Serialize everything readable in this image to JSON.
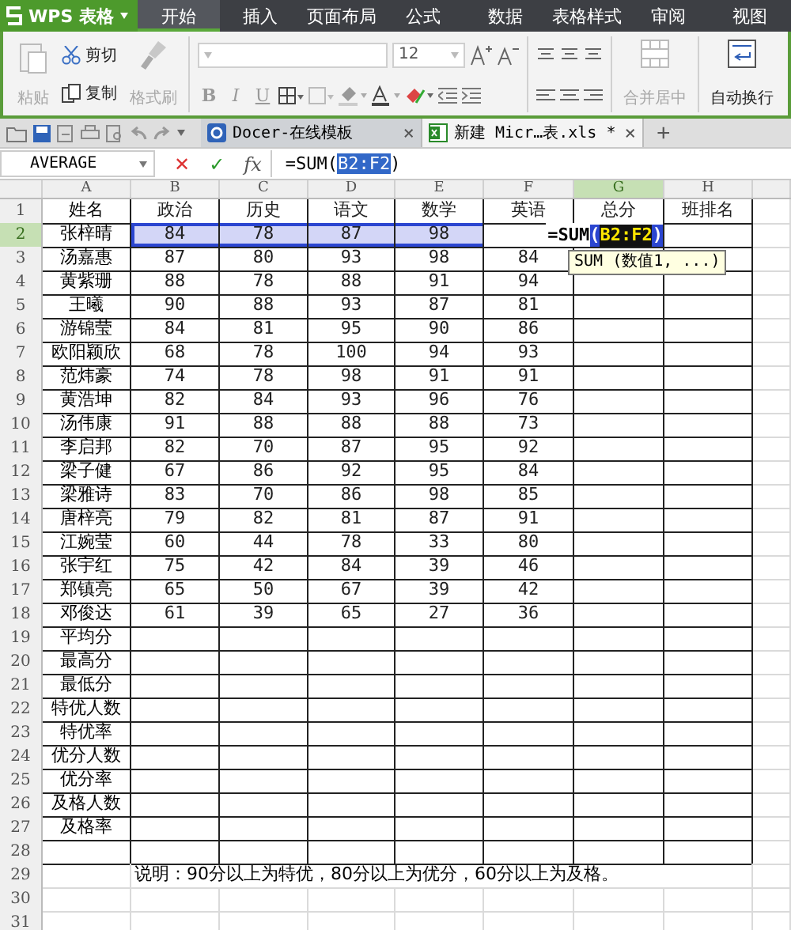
{
  "app": {
    "name": "WPS 表格"
  },
  "menu_tabs": [
    {
      "label": "开始",
      "selected": true
    },
    {
      "label": "插入",
      "selected": false
    },
    {
      "label": "页面布局",
      "selected": false
    },
    {
      "label": "公式",
      "selected": false
    },
    {
      "label": "数据",
      "selected": false
    },
    {
      "label": "表格样式",
      "selected": false
    },
    {
      "label": "审阅",
      "selected": false
    },
    {
      "label": "视图",
      "selected": false
    }
  ],
  "ribbon": {
    "paste": {
      "label": "粘贴",
      "disabled": true
    },
    "cut": {
      "label": "剪切",
      "disabled": false
    },
    "copy": {
      "label": "复制",
      "disabled": false
    },
    "format_painter": {
      "label": "格式刷",
      "disabled": true
    },
    "font_size": "12",
    "style_buttons": [
      "B",
      "I",
      "U"
    ],
    "merge": {
      "label": "合并居中",
      "disabled": true
    },
    "wrap": {
      "label": "自动换行",
      "disabled": false
    }
  },
  "doc_tabs": [
    {
      "title": "Docer-在线模板",
      "close": "×",
      "selected": false
    },
    {
      "title": "新建 Micr…表.xls *",
      "close": "×",
      "selected": true
    }
  ],
  "new_tab": "+",
  "formula_bar": {
    "name_box": "AVERAGE",
    "cancel": "✕",
    "confirm": "✓",
    "function": "fx",
    "formula": [
      {
        "text": "=SUM(",
        "kind": "plain"
      },
      {
        "text": "B2:F2",
        "kind": "ref"
      },
      {
        "text": ")",
        "kind": "plain"
      }
    ]
  },
  "sheet": {
    "columns": [
      {
        "label": "A",
        "selected": false
      },
      {
        "label": "B",
        "selected": false
      },
      {
        "label": "C",
        "selected": false
      },
      {
        "label": "D",
        "selected": false
      },
      {
        "label": "E",
        "selected": false
      },
      {
        "label": "F",
        "selected": false
      },
      {
        "label": "G",
        "selected": true
      },
      {
        "label": "H",
        "selected": false
      }
    ],
    "rows": [
      {
        "number": "1",
        "selected": false,
        "bordered": true,
        "cells": [
          {
            "text": "姓名",
            "selected": false
          },
          {
            "text": "政治",
            "selected": false
          },
          {
            "text": "历史",
            "selected": false
          },
          {
            "text": "语文",
            "selected": false
          },
          {
            "text": "数学",
            "selected": false
          },
          {
            "text": "英语",
            "selected": false
          },
          {
            "text": "总分",
            "selected": false
          },
          {
            "text": "班排名",
            "selected": false
          }
        ]
      },
      {
        "number": "2",
        "selected": true,
        "bordered": true,
        "cells": [
          {
            "text": "张梓晴",
            "selected": false
          },
          {
            "text": "84",
            "selected": true
          },
          {
            "text": "78",
            "selected": true
          },
          {
            "text": "87",
            "selected": true
          },
          {
            "text": "98",
            "selected": true
          }
        ],
        "editor": {
          "parts": [
            {
              "text": "=SUM",
              "kind": "plain"
            },
            {
              "text": "(",
              "kind": "paren"
            },
            {
              "text": "B2:F2",
              "kind": "ref"
            },
            {
              "text": ")",
              "kind": "paren"
            }
          ],
          "tooltip": "SUM (数值1, ...)"
        }
      },
      {
        "number": "3",
        "selected": false,
        "bordered": true,
        "cells": [
          {
            "text": "汤嘉惠",
            "selected": false
          },
          {
            "text": "87",
            "selected": false
          },
          {
            "text": "80",
            "selected": false
          },
          {
            "text": "93",
            "selected": false
          },
          {
            "text": "98",
            "selected": false
          },
          {
            "text": "84",
            "selected": false
          }
        ]
      },
      {
        "number": "4",
        "selected": false,
        "bordered": true,
        "cells": [
          {
            "text": "黄紫珊",
            "selected": false
          },
          {
            "text": "88",
            "selected": false
          },
          {
            "text": "78",
            "selected": false
          },
          {
            "text": "88",
            "selected": false
          },
          {
            "text": "91",
            "selected": false
          },
          {
            "text": "94",
            "selected": false
          }
        ]
      },
      {
        "number": "5",
        "selected": false,
        "bordered": true,
        "cells": [
          {
            "text": "王曦",
            "selected": false
          },
          {
            "text": "90",
            "selected": false
          },
          {
            "text": "88",
            "selected": false
          },
          {
            "text": "93",
            "selected": false
          },
          {
            "text": "87",
            "selected": false
          },
          {
            "text": "81",
            "selected": false
          }
        ]
      },
      {
        "number": "6",
        "selected": false,
        "bordered": true,
        "cells": [
          {
            "text": "游锦莹",
            "selected": false
          },
          {
            "text": "84",
            "selected": false
          },
          {
            "text": "81",
            "selected": false
          },
          {
            "text": "95",
            "selected": false
          },
          {
            "text": "90",
            "selected": false
          },
          {
            "text": "86",
            "selected": false
          }
        ]
      },
      {
        "number": "7",
        "selected": false,
        "bordered": true,
        "cells": [
          {
            "text": "欧阳颖欣",
            "selected": false
          },
          {
            "text": "68",
            "selected": false
          },
          {
            "text": "78",
            "selected": false
          },
          {
            "text": "100",
            "selected": false
          },
          {
            "text": "94",
            "selected": false
          },
          {
            "text": "93",
            "selected": false
          }
        ]
      },
      {
        "number": "8",
        "selected": false,
        "bordered": true,
        "cells": [
          {
            "text": "范炜豪",
            "selected": false
          },
          {
            "text": "74",
            "selected": false
          },
          {
            "text": "78",
            "selected": false
          },
          {
            "text": "98",
            "selected": false
          },
          {
            "text": "91",
            "selected": false
          },
          {
            "text": "91",
            "selected": false
          }
        ]
      },
      {
        "number": "9",
        "selected": false,
        "bordered": true,
        "cells": [
          {
            "text": "黄浩坤",
            "selected": false
          },
          {
            "text": "82",
            "selected": false
          },
          {
            "text": "84",
            "selected": false
          },
          {
            "text": "93",
            "selected": false
          },
          {
            "text": "96",
            "selected": false
          },
          {
            "text": "76",
            "selected": false
          }
        ]
      },
      {
        "number": "10",
        "selected": false,
        "bordered": true,
        "cells": [
          {
            "text": "汤伟康",
            "selected": false
          },
          {
            "text": "91",
            "selected": false
          },
          {
            "text": "88",
            "selected": false
          },
          {
            "text": "88",
            "selected": false
          },
          {
            "text": "88",
            "selected": false
          },
          {
            "text": "73",
            "selected": false
          }
        ]
      },
      {
        "number": "11",
        "selected": false,
        "bordered": true,
        "cells": [
          {
            "text": "李启邦",
            "selected": false
          },
          {
            "text": "82",
            "selected": false
          },
          {
            "text": "70",
            "selected": false
          },
          {
            "text": "87",
            "selected": false
          },
          {
            "text": "95",
            "selected": false
          },
          {
            "text": "92",
            "selected": false
          }
        ]
      },
      {
        "number": "12",
        "selected": false,
        "bordered": true,
        "cells": [
          {
            "text": "梁子健",
            "selected": false
          },
          {
            "text": "67",
            "selected": false
          },
          {
            "text": "86",
            "selected": false
          },
          {
            "text": "92",
            "selected": false
          },
          {
            "text": "95",
            "selected": false
          },
          {
            "text": "84",
            "selected": false
          }
        ]
      },
      {
        "number": "13",
        "selected": false,
        "bordered": true,
        "cells": [
          {
            "text": "梁雅诗",
            "selected": false
          },
          {
            "text": "83",
            "selected": false
          },
          {
            "text": "70",
            "selected": false
          },
          {
            "text": "86",
            "selected": false
          },
          {
            "text": "98",
            "selected": false
          },
          {
            "text": "85",
            "selected": false
          }
        ]
      },
      {
        "number": "14",
        "selected": false,
        "bordered": true,
        "cells": [
          {
            "text": "唐梓亮",
            "selected": false
          },
          {
            "text": "79",
            "selected": false
          },
          {
            "text": "82",
            "selected": false
          },
          {
            "text": "81",
            "selected": false
          },
          {
            "text": "87",
            "selected": false
          },
          {
            "text": "91",
            "selected": false
          }
        ]
      },
      {
        "number": "15",
        "selected": false,
        "bordered": true,
        "cells": [
          {
            "text": "江婉莹",
            "selected": false
          },
          {
            "text": "60",
            "selected": false
          },
          {
            "text": "44",
            "selected": false
          },
          {
            "text": "78",
            "selected": false
          },
          {
            "text": "33",
            "selected": false
          },
          {
            "text": "80",
            "selected": false
          }
        ]
      },
      {
        "number": "16",
        "selected": false,
        "bordered": true,
        "cells": [
          {
            "text": "张宇红",
            "selected": false
          },
          {
            "text": "75",
            "selected": false
          },
          {
            "text": "42",
            "selected": false
          },
          {
            "text": "84",
            "selected": false
          },
          {
            "text": "39",
            "selected": false
          },
          {
            "text": "46",
            "selected": false
          }
        ]
      },
      {
        "number": "17",
        "selected": false,
        "bordered": true,
        "cells": [
          {
            "text": "郑镇亮",
            "selected": false
          },
          {
            "text": "65",
            "selected": false
          },
          {
            "text": "50",
            "selected": false
          },
          {
            "text": "67",
            "selected": false
          },
          {
            "text": "39",
            "selected": false
          },
          {
            "text": "42",
            "selected": false
          }
        ]
      },
      {
        "number": "18",
        "selected": false,
        "bordered": true,
        "cells": [
          {
            "text": "邓俊达",
            "selected": false
          },
          {
            "text": "61",
            "selected": false
          },
          {
            "text": "39",
            "selected": false
          },
          {
            "text": "65",
            "selected": false
          },
          {
            "text": "27",
            "selected": false
          },
          {
            "text": "36",
            "selected": false
          }
        ]
      },
      {
        "number": "19",
        "selected": false,
        "bordered": true,
        "cells": [
          {
            "text": "平均分",
            "selected": false
          }
        ]
      },
      {
        "number": "20",
        "selected": false,
        "bordered": true,
        "cells": [
          {
            "text": "最高分",
            "selected": false
          }
        ]
      },
      {
        "number": "21",
        "selected": false,
        "bordered": true,
        "cells": [
          {
            "text": "最低分",
            "selected": false
          }
        ]
      },
      {
        "number": "22",
        "selected": false,
        "bordered": true,
        "cells": [
          {
            "text": "特优人数",
            "selected": false
          }
        ]
      },
      {
        "number": "23",
        "selected": false,
        "bordered": true,
        "cells": [
          {
            "text": "特优率",
            "selected": false
          }
        ]
      },
      {
        "number": "24",
        "selected": false,
        "bordered": true,
        "cells": [
          {
            "text": "优分人数",
            "selected": false
          }
        ]
      },
      {
        "number": "25",
        "selected": false,
        "bordered": true,
        "cells": [
          {
            "text": "优分率",
            "selected": false
          }
        ]
      },
      {
        "number": "26",
        "selected": false,
        "bordered": true,
        "cells": [
          {
            "text": "及格人数",
            "selected": false
          }
        ]
      },
      {
        "number": "27",
        "selected": false,
        "bordered": true,
        "cells": [
          {
            "text": "及格率",
            "selected": false
          }
        ]
      },
      {
        "number": "28",
        "selected": false,
        "bordered": true
      },
      {
        "number": "29",
        "selected": false,
        "bordered": false,
        "note": "说明：90分以上为特优，80分以上为优分，60分以上为及格。"
      },
      {
        "number": "30",
        "selected": false,
        "bordered": false
      },
      {
        "number": "31",
        "selected": false,
        "bordered": false
      }
    ]
  }
}
